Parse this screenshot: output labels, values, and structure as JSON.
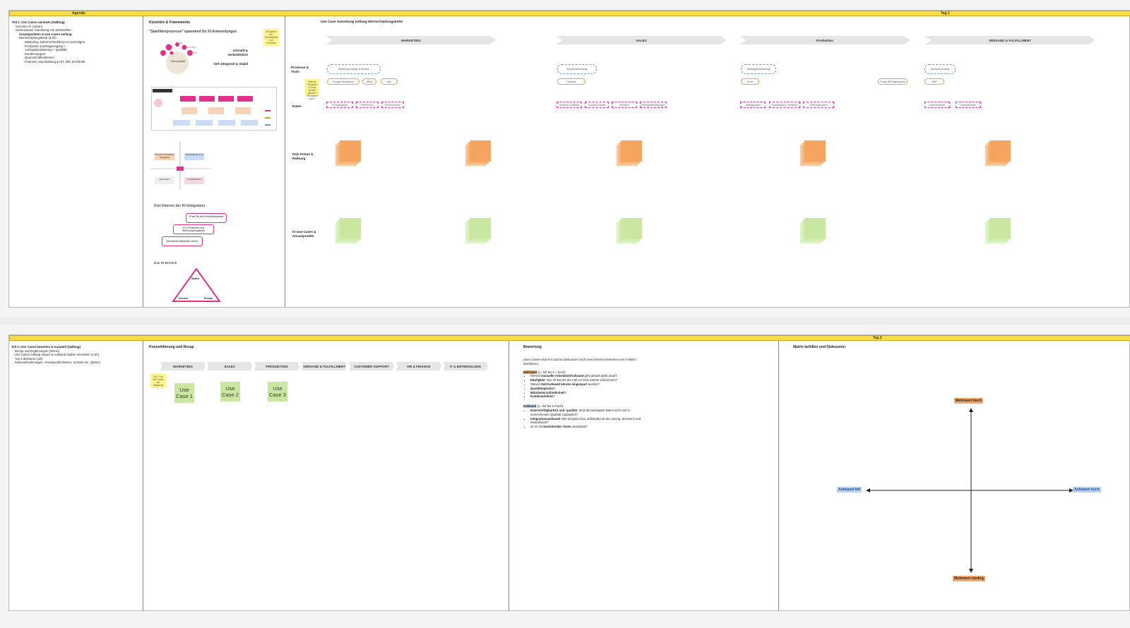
{
  "top": {
    "bar_agenda": "Agenda",
    "bar_tag": "Tag 1",
    "agenda": {
      "title": "Teil 1: Use Cases sammeln (Halbtag)",
      "items": [
        "Kurzintro KI (15min)",
        "Gemeinsame Sammlung von potentiellen",
        "Ansatzpunkten & Use Cases entlang",
        "Wertschöpfungskette (3,5h)",
        "Marketing, Sales/Vertrieb/Key Account Mgmt",
        "Produktion (Auftragseingang +",
        "Auftragsbearbeitung + Qualität)",
        "Kundensupport",
        "Querschnittfunktionen:",
        "Finanzen, Buchhaltung & HR, falls Zeit bleibt"
      ]
    },
    "intro": {
      "title": "Kurzintro & Frameworks",
      "quote": "\"Satellitenprozesse\" spannend für KI-Anwendungen",
      "center_label": "Kern-produkt",
      "sat_labels": [
        "Marketing",
        "Service",
        "Sales"
      ],
      "fast": "schnell & veränderlich",
      "stable": "tief integriert & stabil",
      "note": "Wo gibt es wo? Schnittstellen und Prozesse",
      "section2": "Drei Ebenen der KI-Integration",
      "levels": [
        "KI als Teil des Geschäftsmodells",
        "KI in Prozessen und Wertschöpfungskette",
        "Individuelle Mitarbeiter-Ebene"
      ],
      "section3": "Das KI-Dreieck",
      "triangle": [
        "Modell",
        "Kontext",
        "Prompt"
      ],
      "quad": [
        "Prozess & Workflow-Integration",
        "Tool-Features & KI",
        "Quick Win?",
        "Ki-Assistenten"
      ]
    },
    "board": {
      "title": "Use Case Sammlung entlang Wertschöpfungskette",
      "chevrons": [
        "MARKETING",
        "SALES",
        "Produktion",
        "VERSAND & FULFILLMENT"
      ],
      "rows": [
        "Prozesse & Tools",
        "Daten",
        "Pain Points & Reibung",
        "KI Use Cases & Ansatzpunkte"
      ],
      "proc_dashed": [
        "Marketing-Kanäle & Medien",
        "Kundenbetreuung",
        "Auftragsbearbeitung",
        "Versand-prozess"
      ],
      "tools_marketing": [
        "Google Workspace",
        "Meta",
        "Wix"
      ],
      "tools_sales": [
        "Hubspot"
      ],
      "tools_prod": [
        "Excel",
        "Power BI Dashboards"
      ],
      "tools_versand": [
        "SAP"
      ],
      "data_marketing": [
        "Produktkatalog",
        "Referenzen",
        "Preisstrukturen"
      ],
      "data_sales": [
        "Vertriebs-Leitfäden",
        "Kundenkontakte",
        "Anfragen",
        "Auftragsbestätigungen"
      ],
      "data_prod": [
        "Auftragsdaten",
        "Produktdaten / Varianten",
        "Lieferantendaten"
      ],
      "data_versand": [
        "Lieferadressen",
        "Versandkosten"
      ],
      "note_marketing": "Welche Prozesse & Tools werden genutzt? Wo kommt Input?"
    }
  },
  "bottom": {
    "bar_tag": "Tag 2",
    "agenda": {
      "title": "Teil 2: Use Cases bewerten & Auswahl (Halbtag)",
      "items": [
        "Recap und Ergänzungen (30min)",
        "Use Cases entlang Impact & Aufwand sauber einordnen (1,5h)",
        "Top 3 definieren (1h)",
        "Datenanforderungen, Verantwortlichkeiten, Schritte etc. (30min)"
      ]
    },
    "consolidation": {
      "title": "Konsolidierung und Recap",
      "chevrons": [
        "MARKETING",
        "SALES",
        "PRODUKTION",
        "VERSAND & FULFILLMENT",
        "CUSTOMER SUPPORT",
        "HR & FINANCE",
        "IT & ENTWICKLUNG"
      ],
      "note": "Die 3 Top Use Cases als Startpunkt",
      "use_cases": [
        "Use Case 1",
        "Use Case 2",
        "Use Case 3"
      ]
    },
    "evaluation": {
      "title": "Bewertung",
      "intro": "Uses Cases einzeln in kurzer Diskussion nach zwei Kriterien bewerten und in Matrix überführen:",
      "mehrwert_label": "Mehrwert",
      "mehrwert_scale": "(1= tief bis 5 = hoch):",
      "mehrwert_items": [
        [
          "Wieviel ",
          "manuelle Arbeit/Zeit/Aufwand",
          " geht aktuell dafür drauf?"
        ],
        [
          "",
          "Häufigkeit",
          ": Wie oft kommt der Fall vor bzw. könnte vorkommen?"
        ],
        [
          "Wieviel ",
          "Zeit/Aufwand könnte eingespart",
          " werden?"
        ],
        [
          "",
          "Qualitätsgewinn",
          "?"
        ],
        [
          "",
          "Mitarbeiterzufriedenheit",
          "?"
        ],
        [
          "",
          "Kundenerlebnis",
          "?"
        ]
      ],
      "aufwand_label": "Aufwand",
      "aufwand_scale": "(1= tief bis 5=hoch):",
      "aufwand_items": [
        [
          "",
          "Datenverfügbarkeit und -qualität",
          ": Sind die benötigten Daten sicht und in ausreichender Qualität zugänglich?"
        ],
        [
          "",
          "Integrationsaufwand",
          ": Wie komplex bzw. aufwändig ist die Lösung, technisch und Zeitaufwand?"
        ],
        [
          "Ist es mit ",
          "bestehenden Tools",
          " umsetzbar?"
        ]
      ]
    },
    "matrix": {
      "title": "Matrix befüllen und Diskussion",
      "top": "Mehrwert hoch",
      "bottom": "Mehrwert niedrig",
      "left": "Aufwand tief",
      "right": "Aufwand hoch"
    }
  },
  "colors": {
    "bar": "#f7dc4a",
    "orange": "#f5a55f",
    "green": "#c9e7a0",
    "pink": "#e0328a",
    "blue": "#6c9bd8"
  }
}
